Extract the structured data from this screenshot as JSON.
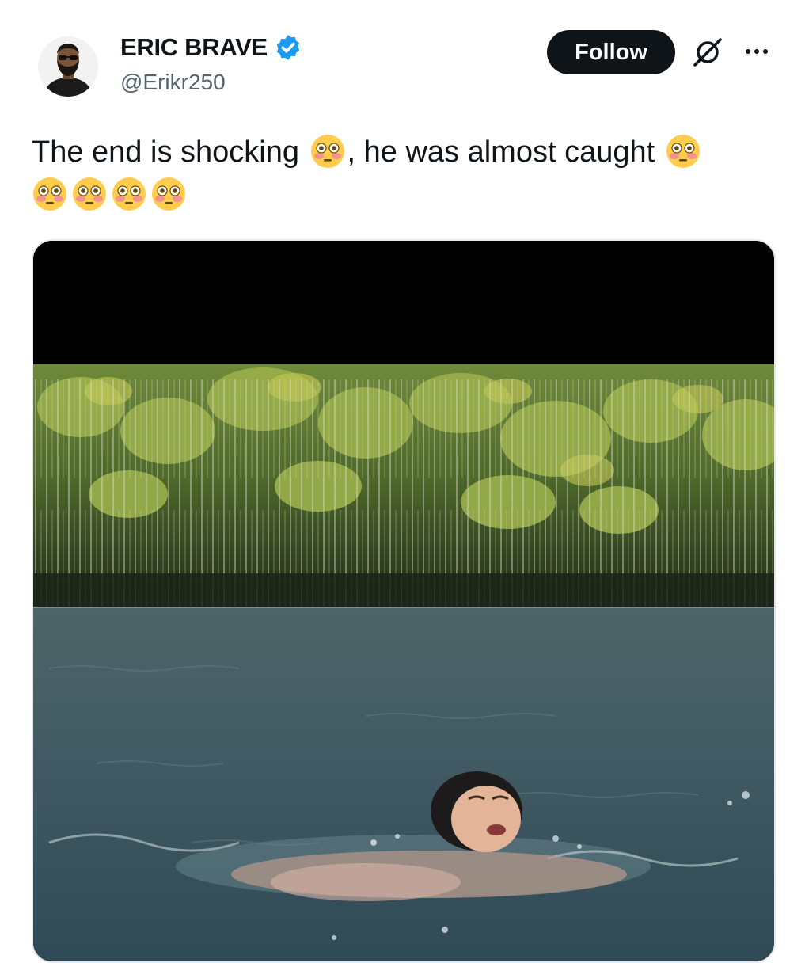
{
  "user": {
    "display_name": "ERIC BRAVE",
    "handle": "@Erikr250",
    "verified": true,
    "verified_color": "#1d9bf0"
  },
  "actions": {
    "follow_label": "Follow",
    "grok_icon": "grok-icon",
    "more_icon": "more-icon"
  },
  "tweet": {
    "text_part1": "The end is shocking ",
    "text_part2": ", he was almost caught ",
    "emoji": "flushed-face",
    "trailing_emoji_count": 4
  },
  "media": {
    "type": "video-thumbnail",
    "description_icon": "video-frame"
  },
  "colors": {
    "text_primary": "#0f1419",
    "text_secondary": "#536471",
    "button_bg": "#0f1419",
    "button_text": "#ffffff"
  }
}
